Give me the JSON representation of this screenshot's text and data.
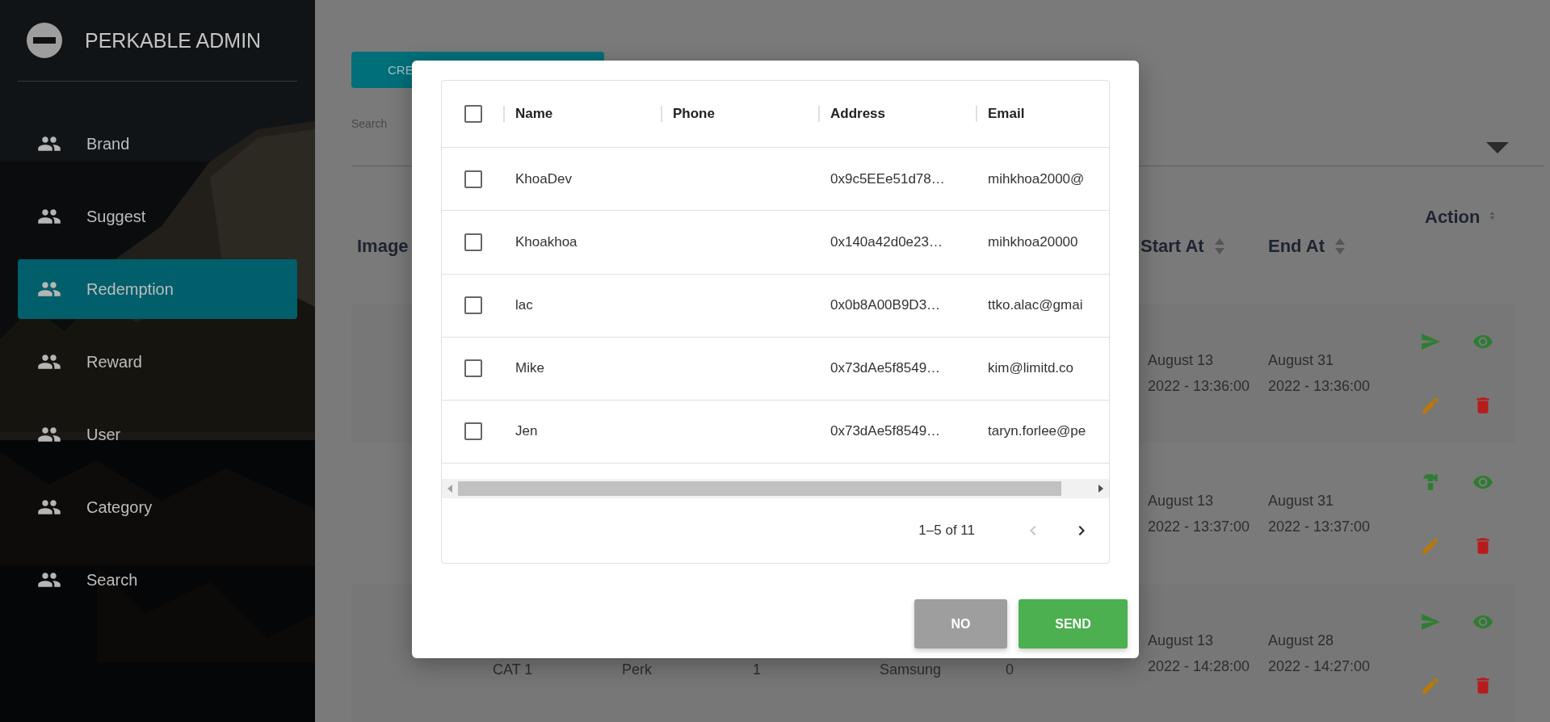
{
  "sidebar": {
    "title": "PERKABLE ADMIN",
    "items": [
      {
        "label": "Brand",
        "selected": false
      },
      {
        "label": "Suggest",
        "selected": false
      },
      {
        "label": "Redemption",
        "selected": true
      },
      {
        "label": "Reward",
        "selected": false
      },
      {
        "label": "User",
        "selected": false
      },
      {
        "label": "Category",
        "selected": false
      },
      {
        "label": "Search",
        "selected": false
      }
    ]
  },
  "page": {
    "create_button": "CRE",
    "search_label": "Search",
    "table": {
      "columns": [
        {
          "label": "Image",
          "sortable": false
        },
        {
          "label": "Start At",
          "sortable": true
        },
        {
          "label": "End At",
          "sortable": true
        },
        {
          "label": "Action",
          "sortable": true
        }
      ],
      "rows": [
        {
          "start_date": "August 13",
          "start_time": "2022 - 13:36:00",
          "end_date": "August 31",
          "end_time": "2022 - 13:36:00",
          "kind": "send"
        },
        {
          "start_date": "August 13",
          "start_time": "2022 - 13:37:00",
          "end_date": "August 31",
          "end_time": "2022 - 13:37:00",
          "kind": "hammer"
        },
        {
          "cells": [
            "CAT 1",
            "Perk",
            "1",
            "Samsung",
            "0"
          ],
          "start_date": "August 13",
          "start_time": "2022 - 14:28:00",
          "end_date": "August 28",
          "end_time": "2022 - 14:27:00",
          "kind": "send"
        }
      ]
    }
  },
  "dialog": {
    "table": {
      "select_all": {
        "checked": false
      },
      "columns": [
        "Name",
        "Phone",
        "Address",
        "Email"
      ],
      "rows": [
        {
          "checked": false,
          "name": "KhoaDev",
          "address": "0x9c5EEe51d78…",
          "email": "mihkhoa2000@"
        },
        {
          "checked": false,
          "name": "Khoakhoa",
          "address": "0x140a42d0e23…",
          "email": "mihkhoa20000"
        },
        {
          "checked": false,
          "name": "lac",
          "address": "0x0b8A00B9D3…",
          "email": "ttko.alac@gmai"
        },
        {
          "checked": false,
          "name": "Mike",
          "address": "0x73dAe5f8549…",
          "email": "kim@limitd.co"
        },
        {
          "checked": false,
          "name": "Jen",
          "address": "0x73dAe5f8549…",
          "email": "taryn.forlee@pe"
        }
      ],
      "pagination": {
        "range": "1–5 of 11",
        "prev_disabled": true,
        "next_disabled": false
      }
    },
    "buttons": [
      {
        "label": "NO",
        "kind": "cancel"
      },
      {
        "label": "SEND",
        "kind": "confirm"
      }
    ]
  }
}
